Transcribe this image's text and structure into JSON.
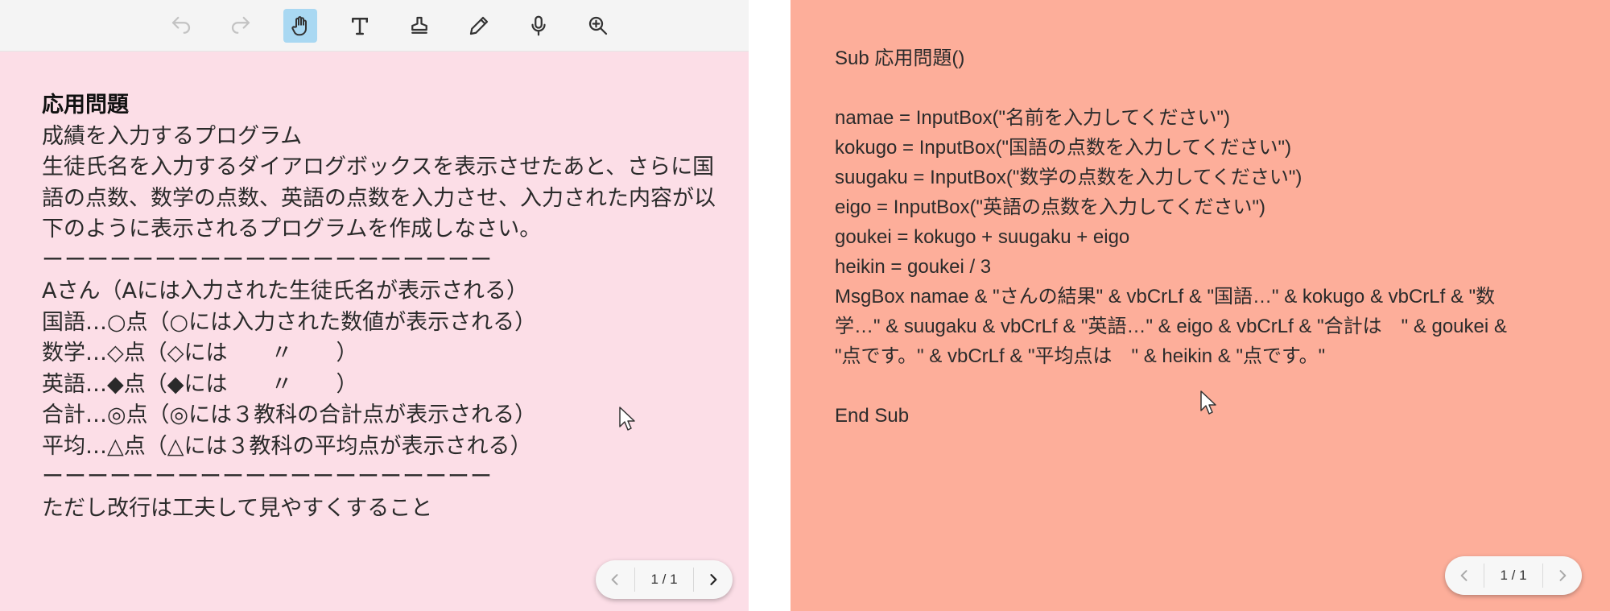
{
  "toolbar": {
    "tools": [
      {
        "name": "undo-icon",
        "state": "disabled"
      },
      {
        "name": "redo-icon",
        "state": "disabled"
      },
      {
        "name": "hand-icon",
        "state": "active"
      },
      {
        "name": "text-icon",
        "state": "normal"
      },
      {
        "name": "stamp-icon",
        "state": "normal"
      },
      {
        "name": "pencil-icon",
        "state": "normal"
      },
      {
        "name": "microphone-icon",
        "state": "normal"
      },
      {
        "name": "zoom-in-icon",
        "state": "normal"
      }
    ]
  },
  "left_doc": {
    "title": "応用問題",
    "subtitle": "成績を入力するプログラム",
    "paragraph": "生徒氏名を入力するダイアログボックスを表示させたあと、さらに国語の点数、数学の点数、英語の点数を入力させ、入力された内容が以下のように表示されるプログラムを作成しなさい。",
    "divider": "ーーーーーーーーーーーーーーーーーーーー",
    "lines": [
      "Aさん（Aには入力された生徒氏名が表示される）",
      "国語…○点（○には入力された数値が表示される）",
      "数学…◇点（◇には　　〃　　）",
      "英語…◆点（◆には　　〃　　）",
      "合計…◎点（◎には３教科の合計点が表示される）",
      "平均…△点（△には３教科の平均点が表示される）"
    ],
    "divider2": "ーーーーーーーーーーーーーーーーーーーー",
    "note": "ただし改行は工夫して見やすくすること"
  },
  "right_code": {
    "lines": [
      "Sub 応用問題()",
      "",
      "namae = InputBox(\"名前を入力してください\")",
      "kokugo = InputBox(\"国語の点数を入力してください\")",
      "suugaku = InputBox(\"数学の点数を入力してください\")",
      "eigo = InputBox(\"英語の点数を入力してください\")",
      "goukei = kokugo + suugaku + eigo",
      "heikin = goukei / 3",
      "MsgBox namae & \"さんの結果\" & vbCrLf & \"国語…\" & kokugo & vbCrLf & \"数",
      "学…\" & suugaku & vbCrLf & \"英語…\" & eigo & vbCrLf & \"合計は　\" & goukei &",
      "\"点です。\" & vbCrLf & \"平均点は　\" & heikin & \"点です。\"",
      "",
      "End Sub"
    ]
  },
  "pager_left": {
    "label": "1 / 1"
  },
  "pager_right": {
    "label": "1 / 1"
  },
  "colors": {
    "left_bg": "#fcdee7",
    "right_bg": "#fdae9a",
    "toolbar_bg": "#f4f4f4",
    "active_tool": "#a9d8f2"
  }
}
